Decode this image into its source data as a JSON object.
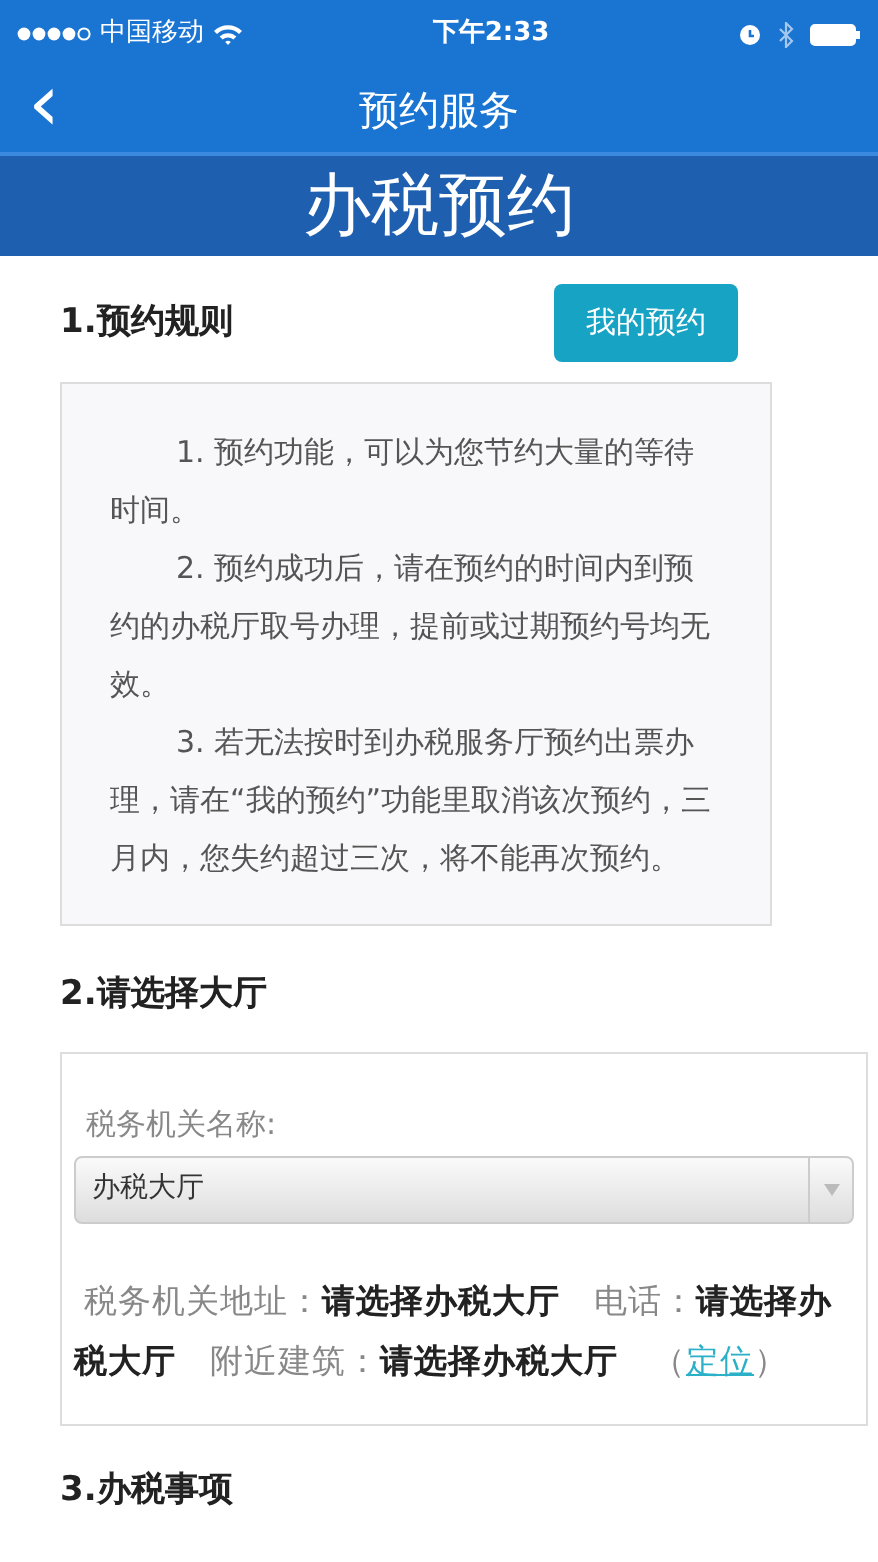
{
  "status_bar": {
    "carrier": "中国移动",
    "time": "下午2:33"
  },
  "nav": {
    "back": "‹",
    "title": "预约服务"
  },
  "banner": {
    "title": "办税预约"
  },
  "sections": [
    {
      "kind": "rules",
      "heading": "1.预约规则",
      "button": "我的预约",
      "rules": [
        "1. 预约功能，可以为您节约大量的等待时间。",
        "2. 预约成功后，请在预约的时间内到预约的办税厅取号办理，提前或过期预约号均无效。",
        "3. 若无法按时到办税服务厅预约出票办理，请在“我的预约”功能里取消该次预约，三月内，您失约超过三次，将不能再次预约。"
      ]
    },
    {
      "kind": "hall",
      "heading": "2.请选择大厅",
      "field_label": "税务机关名称:",
      "select_value": "办税大厅",
      "info": "税务机关地址：**请选择办税大厅**　电话：**请选择办税大厅**　附近建筑：**请选择办税大厅**　（",
      "link": "定位",
      "info_end": "）"
    },
    {
      "kind": "heading_only",
      "heading": "3.办税事项"
    }
  ]
}
